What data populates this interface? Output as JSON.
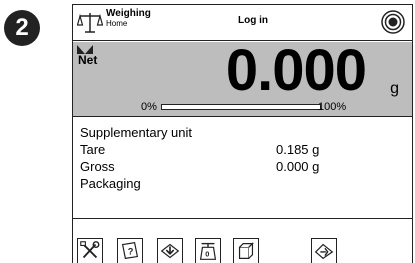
{
  "step_badge": "2",
  "header": {
    "mode_title": "Weighing",
    "mode_subtitle": "Home",
    "login_label": "Log in",
    "mode_icon": "scale-icon",
    "record_icon": "record-button-icon"
  },
  "weighing": {
    "stability_icon": "stable-indicator-icon",
    "net_label": "Net",
    "value": "0.000",
    "unit": "g",
    "bar_min_label": "0%",
    "bar_max_label": "100%",
    "load_fraction": 0.0
  },
  "info": {
    "rows": [
      {
        "label": "Supplementary unit",
        "value": ""
      },
      {
        "label": "Tare",
        "value": "0.185 g"
      },
      {
        "label": "Gross",
        "value": "0.000 g"
      },
      {
        "label": "Packaging",
        "value": ""
      }
    ]
  },
  "toolbar": {
    "buttons": [
      {
        "icon": "settings-tools-icon"
      },
      {
        "icon": "help-icon"
      },
      {
        "icon": "tare-icon"
      },
      {
        "icon": "zero-icon"
      },
      {
        "icon": "packaging-icon"
      },
      {
        "icon": "print-icon"
      }
    ]
  },
  "colors": {
    "weighing_panel_background": "#bdbdbd",
    "border": "#222222",
    "badge_background": "#222222"
  }
}
